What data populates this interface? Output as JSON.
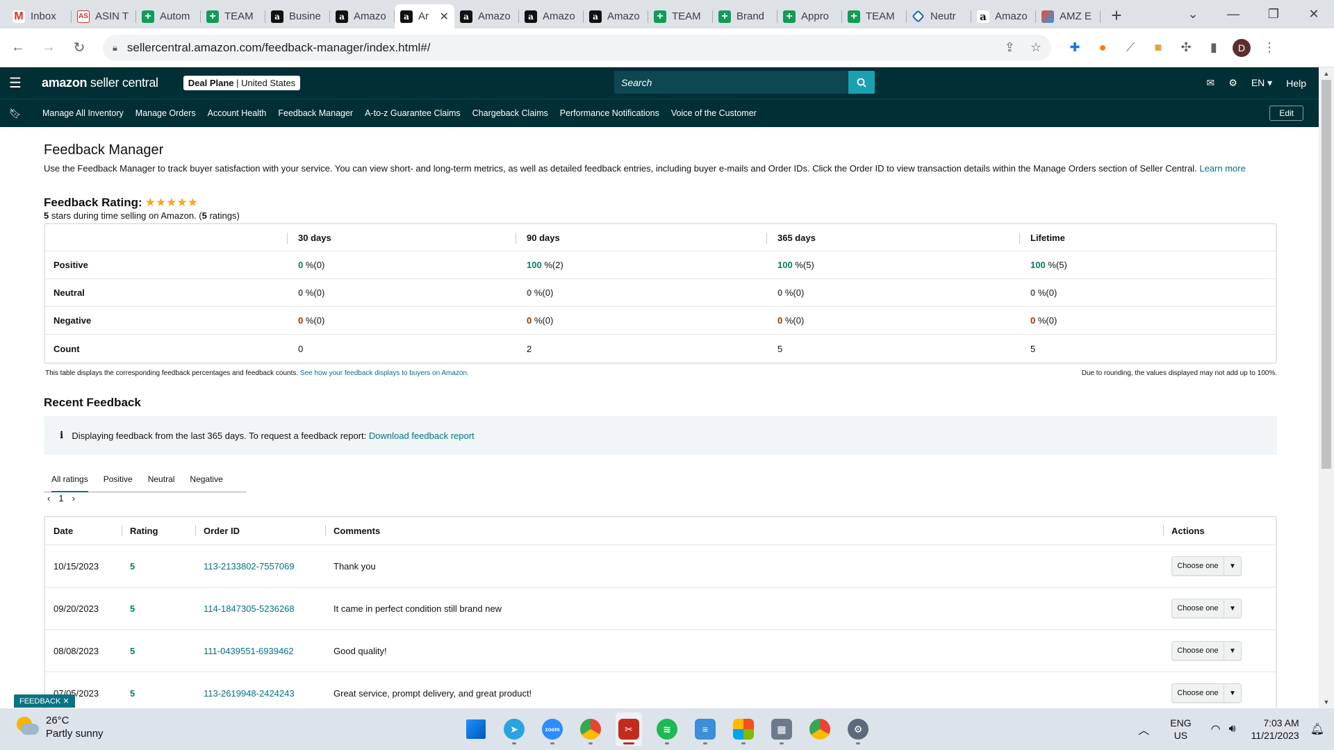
{
  "browser": {
    "tabs": [
      {
        "label": "Inbox",
        "icon": "gmail",
        "glyph": "M"
      },
      {
        "label": "ASIN T",
        "icon": "asin",
        "glyph": "AS"
      },
      {
        "label": "Autom",
        "icon": "sheet",
        "glyph": "+"
      },
      {
        "label": "TEAM",
        "icon": "sheet",
        "glyph": "+"
      },
      {
        "label": "Busine",
        "icon": "amz",
        "glyph": "a"
      },
      {
        "label": "Amazo",
        "icon": "amz",
        "glyph": "a"
      },
      {
        "label": "Ar",
        "icon": "amz",
        "glyph": "a",
        "active": true
      },
      {
        "label": "Amazo",
        "icon": "amz",
        "glyph": "a"
      },
      {
        "label": "Amazo",
        "icon": "amz",
        "glyph": "a"
      },
      {
        "label": "Amazo",
        "icon": "amz",
        "glyph": "a"
      },
      {
        "label": "TEAM",
        "icon": "sheet",
        "glyph": "+"
      },
      {
        "label": "Brand",
        "icon": "sheet",
        "glyph": "+"
      },
      {
        "label": "Appro",
        "icon": "sheet",
        "glyph": "+"
      },
      {
        "label": "TEAM",
        "icon": "sheet",
        "glyph": "+"
      },
      {
        "label": "Neutr",
        "icon": "neutr",
        "glyph": ""
      },
      {
        "label": "Amazo",
        "icon": "amzw",
        "glyph": "a"
      },
      {
        "label": "AMZ E",
        "icon": "amze",
        "glyph": ""
      }
    ],
    "url": "sellercentral.amazon.com/feedback-manager/index.html#/",
    "profile_initial": "D"
  },
  "header": {
    "logo_bold": "amazon",
    "logo_rest": " seller central",
    "store_name": "Deal Plane",
    "store_region": "United States",
    "search_placeholder": "Search",
    "language": "EN",
    "help": "Help"
  },
  "nav": {
    "items": [
      "Manage All Inventory",
      "Manage Orders",
      "Account Health",
      "Feedback Manager",
      "A-to-z Guarantee Claims",
      "Chargeback Claims",
      "Performance Notifications",
      "Voice of the Customer"
    ],
    "edit": "Edit"
  },
  "page": {
    "title": "Feedback Manager",
    "intro": "Use the Feedback Manager to track buyer satisfaction with your service. You can view short- and long-term metrics, as well as detailed feedback entries, including buyer e-mails and Order IDs. Click the Order ID to view transaction details within the Manage Orders section of Seller Central.",
    "learn_more": "Learn more",
    "rating_label": "Feedback Rating:",
    "stars": 5,
    "rating_sub_1": "5",
    "rating_sub_2": " stars during time selling on Amazon. (",
    "rating_sub_3": "5",
    "rating_sub_4": " ratings)"
  },
  "metrics": {
    "columns": [
      "",
      "30 days",
      "90 days",
      "365 days",
      "Lifetime"
    ],
    "rows": [
      {
        "label": "Positive",
        "kind": "pos",
        "cells": [
          {
            "pct": "0",
            "count": "%(0)"
          },
          {
            "pct": "100",
            "count": "%(2)"
          },
          {
            "pct": "100",
            "count": "%(5)"
          },
          {
            "pct": "100",
            "count": "%(5)"
          }
        ]
      },
      {
        "label": "Neutral",
        "kind": "neu",
        "cells": [
          {
            "pct": "0",
            "count": "%(0)"
          },
          {
            "pct": "0",
            "count": "%(0)"
          },
          {
            "pct": "0",
            "count": "%(0)"
          },
          {
            "pct": "0",
            "count": "%(0)"
          }
        ]
      },
      {
        "label": "Negative",
        "kind": "neg",
        "cells": [
          {
            "pct": "0",
            "count": "%(0)"
          },
          {
            "pct": "0",
            "count": "%(0)"
          },
          {
            "pct": "0",
            "count": "%(0)"
          },
          {
            "pct": "0",
            "count": "%(0)"
          }
        ]
      }
    ],
    "count_label": "Count",
    "counts": [
      "0",
      "2",
      "5",
      "5"
    ],
    "footnote_left": "This table displays the corresponding feedback percentages and feedback counts.",
    "footnote_link": "See how your feedback displays to buyers on Amazon.",
    "footnote_right": "Due to rounding, the values displayed may not add up to 100%."
  },
  "recent": {
    "title": "Recent Feedback",
    "notice": "Displaying feedback from the last 365 days. To request a feedback report:",
    "notice_link": "Download feedback report",
    "filter_tabs": [
      "All ratings",
      "Positive",
      "Neutral",
      "Negative"
    ],
    "page": "1",
    "columns": [
      "Date",
      "Rating",
      "Order ID",
      "Comments",
      "Actions"
    ],
    "rows": [
      {
        "date": "10/15/2023",
        "rating": "5",
        "order_id": "113-2133802-7557069",
        "comment": "Thank you"
      },
      {
        "date": "09/20/2023",
        "rating": "5",
        "order_id": "114-1847305-5236268",
        "comment": "It came in perfect condition still brand new"
      },
      {
        "date": "08/08/2023",
        "rating": "5",
        "order_id": "111-0439551-6939462",
        "comment": "Good quality!"
      },
      {
        "date": "07/05/2023",
        "rating": "5",
        "order_id": "113-2619948-2424243",
        "comment": "Great service, prompt delivery, and great product!"
      }
    ],
    "action_label": "Choose one"
  },
  "feedback_tab": "FEEDBACK ✕",
  "taskbar": {
    "temp": "26°C",
    "weather": "Partly sunny",
    "lang_1": "ENG",
    "lang_2": "US",
    "time": "7:03 AM",
    "date": "11/21/2023"
  }
}
